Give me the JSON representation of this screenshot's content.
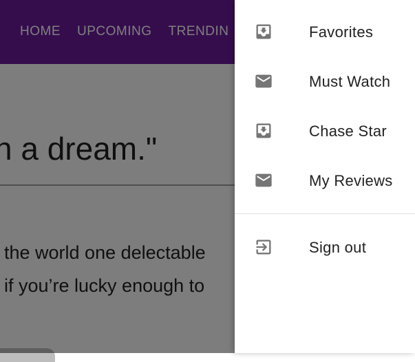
{
  "appbar": {
    "nav": [
      "HOME",
      "UPCOMING",
      "TRENDIN"
    ]
  },
  "content": {
    "quote": "n a dream.\"",
    "paragraph": [
      "the world one delectable",
      "if you’re lucky enough to"
    ]
  },
  "drawer": {
    "items": [
      {
        "label": "Favorites",
        "icon": "inbox-download-icon"
      },
      {
        "label": "Must Watch",
        "icon": "mail-icon"
      },
      {
        "label": "Chase Star",
        "icon": "inbox-download-icon"
      },
      {
        "label": "My Reviews",
        "icon": "mail-icon"
      }
    ],
    "signout": {
      "label": "Sign out",
      "icon": "sign-out-icon"
    }
  },
  "colors": {
    "appbar": "#6a1b9a",
    "icon": "#757575",
    "text": "#212121"
  }
}
